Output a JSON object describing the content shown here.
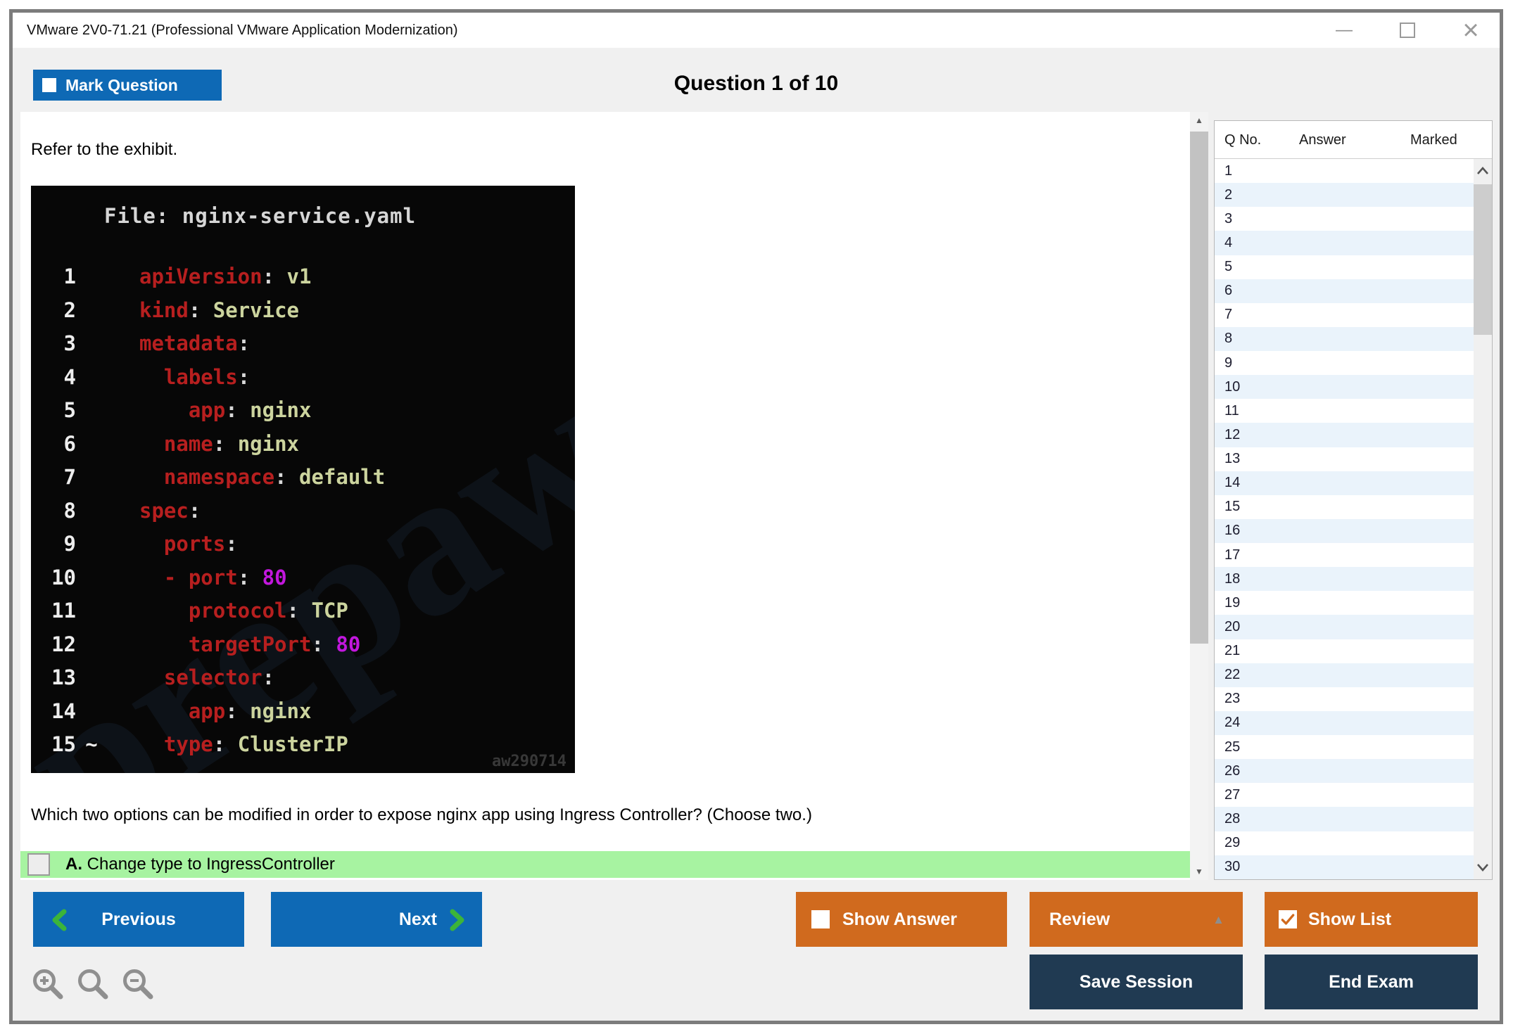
{
  "window": {
    "title": "VMware 2V0-71.21 (Professional VMware Application Modernization)"
  },
  "header": {
    "mark_question_label": "Mark Question",
    "counter": "Question 1 of 10"
  },
  "main": {
    "prompt": "Refer to the exhibit.",
    "exhibit": {
      "file_title": "File: nginx-service.yaml",
      "watermark": "prepaway",
      "corner_mark": "aw290714",
      "lines": [
        {
          "n": "1",
          "pre": "",
          "key": "apiVersion",
          "val": "v1",
          "vt": "str"
        },
        {
          "n": "2",
          "pre": "",
          "key": "kind",
          "val": "Service",
          "vt": "str"
        },
        {
          "n": "3",
          "pre": "",
          "key": "metadata",
          "val": "",
          "vt": ""
        },
        {
          "n": "4",
          "pre": "  ",
          "key": "labels",
          "val": "",
          "vt": ""
        },
        {
          "n": "5",
          "pre": "    ",
          "key": "app",
          "val": "nginx",
          "vt": "str"
        },
        {
          "n": "6",
          "pre": "  ",
          "key": "name",
          "val": "nginx",
          "vt": "str"
        },
        {
          "n": "7",
          "pre": "  ",
          "key": "namespace",
          "val": "default",
          "vt": "str"
        },
        {
          "n": "8",
          "pre": "",
          "key": "spec",
          "val": "",
          "vt": ""
        },
        {
          "n": "9",
          "pre": "  ",
          "key": "ports",
          "val": "",
          "vt": ""
        },
        {
          "n": "10",
          "pre": "  ",
          "dash": "- ",
          "key": "port",
          "val": "80",
          "vt": "num"
        },
        {
          "n": "11",
          "pre": "    ",
          "key": "protocol",
          "val": "TCP",
          "vt": "str"
        },
        {
          "n": "12",
          "pre": "    ",
          "key": "targetPort",
          "val": "80",
          "vt": "num"
        },
        {
          "n": "13",
          "pre": "  ",
          "key": "selector",
          "val": "",
          "vt": ""
        },
        {
          "n": "14",
          "pre": "    ",
          "key": "app",
          "val": "nginx",
          "vt": "str"
        },
        {
          "n": "15",
          "gutter_mark": "~",
          "pre": "  ",
          "key": "type",
          "val": "ClusterIP",
          "vt": "str"
        }
      ]
    },
    "question": "Which two options can be modified in order to expose nginx app using Ingress Controller? (Choose two.)",
    "options": [
      {
        "letter": "A.",
        "text": "Change type to IngressController",
        "highlighted": true,
        "checked": false
      }
    ]
  },
  "sidebar": {
    "columns": [
      "Q No.",
      "Answer",
      "Marked"
    ],
    "rows": [
      {
        "q": "1",
        "answer": "",
        "marked": ""
      },
      {
        "q": "2",
        "answer": "",
        "marked": ""
      },
      {
        "q": "3",
        "answer": "",
        "marked": ""
      },
      {
        "q": "4",
        "answer": "",
        "marked": ""
      },
      {
        "q": "5",
        "answer": "",
        "marked": ""
      },
      {
        "q": "6",
        "answer": "",
        "marked": ""
      },
      {
        "q": "7",
        "answer": "",
        "marked": ""
      },
      {
        "q": "8",
        "answer": "",
        "marked": ""
      },
      {
        "q": "9",
        "answer": "",
        "marked": ""
      },
      {
        "q": "10",
        "answer": "",
        "marked": ""
      },
      {
        "q": "11",
        "answer": "",
        "marked": ""
      },
      {
        "q": "12",
        "answer": "",
        "marked": ""
      },
      {
        "q": "13",
        "answer": "",
        "marked": ""
      },
      {
        "q": "14",
        "answer": "",
        "marked": ""
      },
      {
        "q": "15",
        "answer": "",
        "marked": ""
      },
      {
        "q": "16",
        "answer": "",
        "marked": ""
      },
      {
        "q": "17",
        "answer": "",
        "marked": ""
      },
      {
        "q": "18",
        "answer": "",
        "marked": ""
      },
      {
        "q": "19",
        "answer": "",
        "marked": ""
      },
      {
        "q": "20",
        "answer": "",
        "marked": ""
      },
      {
        "q": "21",
        "answer": "",
        "marked": ""
      },
      {
        "q": "22",
        "answer": "",
        "marked": ""
      },
      {
        "q": "23",
        "answer": "",
        "marked": ""
      },
      {
        "q": "24",
        "answer": "",
        "marked": ""
      },
      {
        "q": "25",
        "answer": "",
        "marked": ""
      },
      {
        "q": "26",
        "answer": "",
        "marked": ""
      },
      {
        "q": "27",
        "answer": "",
        "marked": ""
      },
      {
        "q": "28",
        "answer": "",
        "marked": ""
      },
      {
        "q": "29",
        "answer": "",
        "marked": ""
      },
      {
        "q": "30",
        "answer": "",
        "marked": ""
      }
    ]
  },
  "footer": {
    "previous": "Previous",
    "next": "Next",
    "show_answer": "Show Answer",
    "review": "Review",
    "show_list": "Show List",
    "save_session": "Save Session",
    "end_exam": "End Exam"
  },
  "icons": {
    "minimize": "—",
    "maximize": "window-maximize-box",
    "close": "×",
    "scroll_up": "▲",
    "scroll_down": "▼",
    "review_caret": "▲",
    "zoom_in": "magnifier-plus",
    "zoom_reset": "magnifier",
    "zoom_out": "magnifier-minus"
  },
  "colors": {
    "accent_blue": "#0e69b5",
    "accent_orange": "#d06a1e",
    "navy": "#203a52",
    "highlight_green": "#a7f3a1",
    "chevron_green": "#3cb43a",
    "sidebar_alt_row": "#eaf3fb",
    "code_key": "#b71f1f",
    "code_value": "#ccd49e",
    "code_number": "#c217dd",
    "code_punct": "#d8d8d8"
  }
}
